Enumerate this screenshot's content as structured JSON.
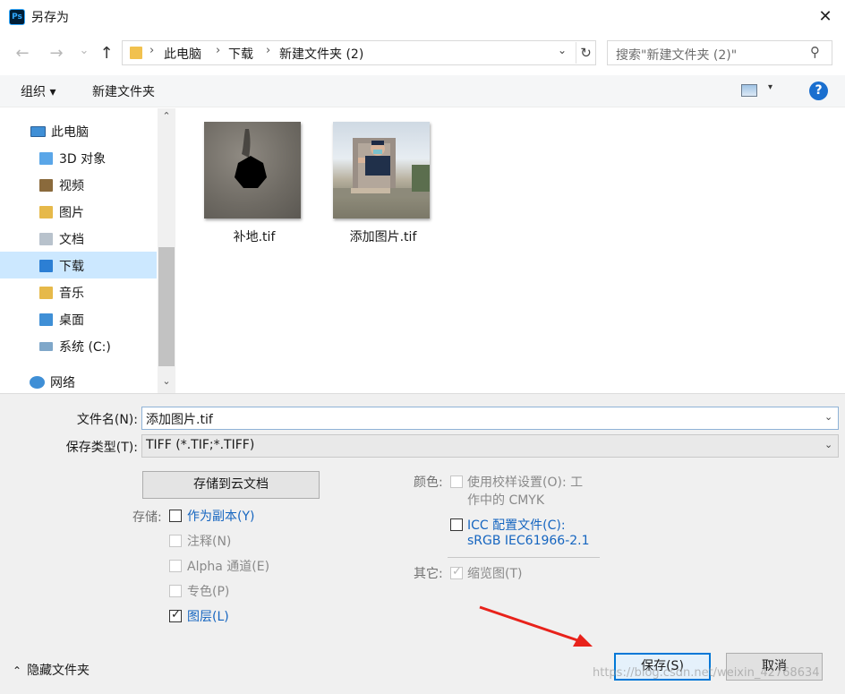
{
  "window": {
    "title": "另存为",
    "app_icon_text": "Ps",
    "close_symbol": "✕"
  },
  "nav": {
    "back_symbol": "←",
    "forward_symbol": "→",
    "recent_symbol": "⌄",
    "up_symbol": "↑",
    "breadcrumb": [
      "此电脑",
      "下载",
      "新建文件夹 (2)"
    ],
    "crumb_separator": "›",
    "dropdown_symbol": "⌄",
    "refresh_symbol": "↻",
    "search_placeholder": "搜索\"新建文件夹 (2)\"",
    "search_symbol": "⚲"
  },
  "toolbar": {
    "organize_label": "组织 ▾",
    "new_folder_label": "新建文件夹",
    "view_dropdown_symbol": "▾",
    "help_symbol": "?"
  },
  "sidebar": {
    "scroll_up": "⌃",
    "scroll_down": "⌄",
    "items": [
      {
        "label": "此电脑",
        "icon": "computer-icon",
        "color": "#3f8fd6"
      },
      {
        "label": "3D 对象",
        "icon": "3d-objects-icon",
        "color": "#5aa6e8"
      },
      {
        "label": "视频",
        "icon": "video-icon",
        "color": "#8a6a3c"
      },
      {
        "label": "图片",
        "icon": "pictures-icon",
        "color": "#e6b94a"
      },
      {
        "label": "文档",
        "icon": "documents-icon",
        "color": "#b8c2cc"
      },
      {
        "label": "下载",
        "icon": "downloads-icon",
        "color": "#2c7fd4",
        "selected": true
      },
      {
        "label": "音乐",
        "icon": "music-icon",
        "color": "#e6b94a"
      },
      {
        "label": "桌面",
        "icon": "desktop-icon",
        "color": "#3f8fd6"
      },
      {
        "label": "系统 (C:)",
        "icon": "drive-icon",
        "color": "#7fa7c9"
      },
      {
        "label": "网络",
        "icon": "network-icon",
        "color": "#3f8fd6"
      }
    ]
  },
  "files": [
    {
      "name": "补地.tif",
      "thumbnail": "inpaint-thumbnail"
    },
    {
      "name": "添加图片.tif",
      "thumbnail": "photo-thumbnail"
    }
  ],
  "form": {
    "filename_label": "文件名(N):",
    "filename_value": "添加图片.tif",
    "filetype_label": "保存类型(T):",
    "filetype_value": "TIFF (*.TIF;*.TIFF)",
    "dropdown_symbol": "⌄",
    "cloud_button": "存储到云文档",
    "storage_label": "存储:",
    "options": [
      {
        "label": "作为副本(Y)",
        "checked": false,
        "enabled": true
      },
      {
        "label": "注释(N)",
        "checked": false,
        "enabled": false
      },
      {
        "label": "Alpha 通道(E)",
        "checked": false,
        "enabled": false
      },
      {
        "label": "专色(P)",
        "checked": false,
        "enabled": false
      },
      {
        "label": "图层(L)",
        "checked": true,
        "enabled": true
      }
    ],
    "color_label": "颜色:",
    "proof_setup_line1": "使用校样设置(O):  工",
    "proof_setup_line2": "作中的 CMYK",
    "icc_line1": "ICC 配置文件(C):",
    "icc_line2": "sRGB IEC61966-2.1",
    "other_label": "其它:",
    "thumbnail_option": "缩览图(T)"
  },
  "footer": {
    "hide_folders": "隐藏文件夹",
    "hide_symbol": "⌃",
    "save_label": "保存(S)",
    "cancel_label": "取消",
    "watermark": "https://blog.csdn.net/weixin_42768634"
  }
}
